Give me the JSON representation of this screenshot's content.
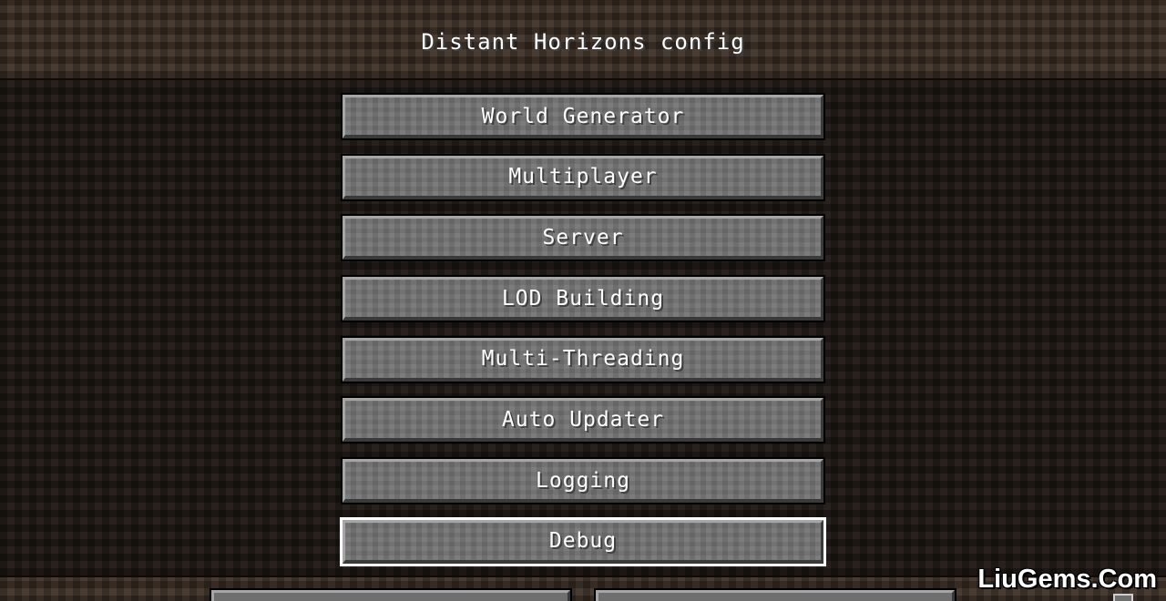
{
  "screen": {
    "title": "Distant Horizons config"
  },
  "menu": {
    "items": [
      {
        "label": "World Generator",
        "selected": false
      },
      {
        "label": "Multiplayer",
        "selected": false
      },
      {
        "label": "Server",
        "selected": false
      },
      {
        "label": "LOD Building",
        "selected": false
      },
      {
        "label": "Multi-Threading",
        "selected": false
      },
      {
        "label": "Auto Updater",
        "selected": false
      },
      {
        "label": "Logging",
        "selected": false
      },
      {
        "label": "Debug",
        "selected": true
      }
    ]
  },
  "watermark": {
    "text": "LiuGems.Com"
  },
  "colors": {
    "button_face": "#6f6f6f",
    "button_text": "#ffffff",
    "selected_outline": "#ffffff",
    "background_dark": "#1f1813"
  }
}
